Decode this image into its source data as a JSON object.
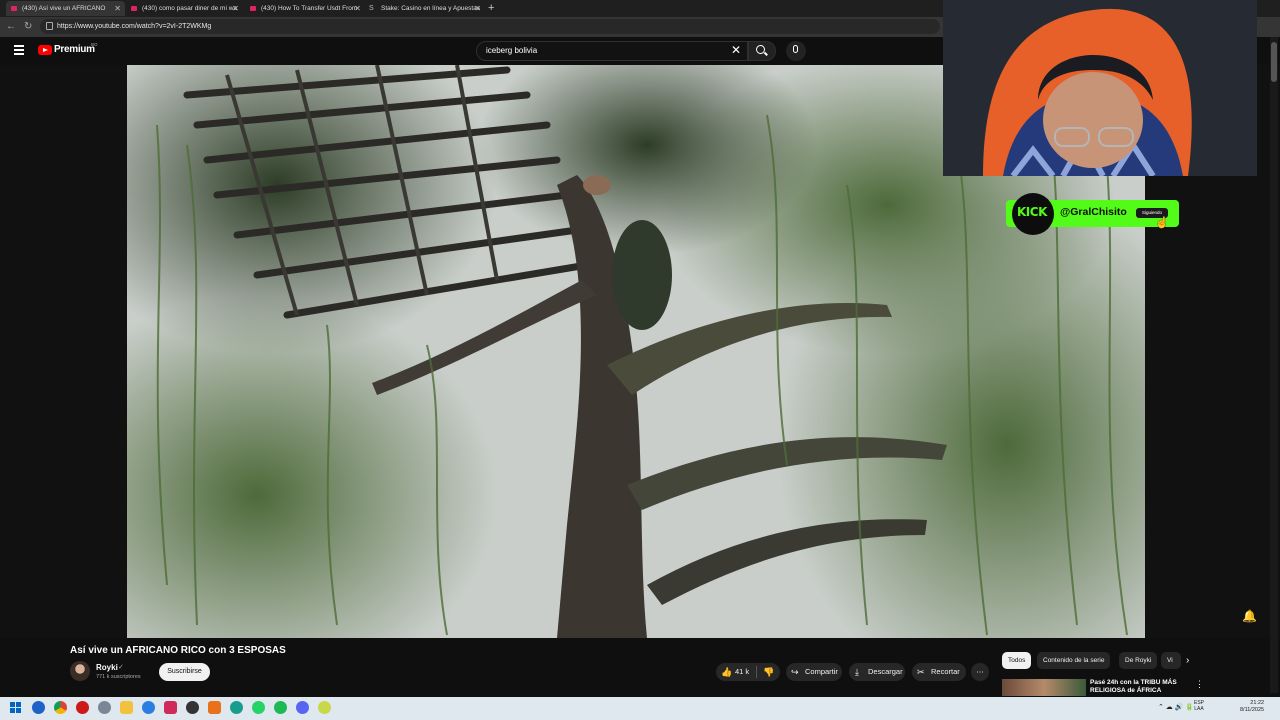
{
  "browser": {
    "tabs": [
      {
        "label": "(430) Así vive un AFRICANO",
        "active": true
      },
      {
        "label": "(430) como pasar diner de mi wa",
        "active": false
      },
      {
        "label": "(430) How To Transfer Usdt From",
        "active": false
      },
      {
        "label": "Stake: Casino en línea y Apuestas",
        "active": false
      }
    ],
    "url": "https://www.youtube.com/watch?v=2vI-2T2WKMg"
  },
  "youtube": {
    "logo_text": "Premium",
    "logo_country": "BO",
    "search_value": "iceberg bolivia"
  },
  "overlay": {
    "kick_logo": "KICK",
    "kick_handle": "@GralChisito",
    "kick_follow": "Siguiendo",
    "kick_color": "#53fc18"
  },
  "video": {
    "title": "Así vive un AFRICANO RICO con 3 ESPOSAS",
    "channel": "Royki",
    "subscribers": "771 k suscriptores",
    "subscribe_label": "Suscribirse",
    "likes": "41 k",
    "share_label": "Compartir",
    "download_label": "Descargar",
    "clip_label": "Recortar"
  },
  "sidebar": {
    "chips": [
      "Todos",
      "Contenido de la serie",
      "De Royki",
      "Vi"
    ],
    "rec_title": "Pasé 24h con la TRIBU MÁS RELIGIOSA de ÁFRICA"
  },
  "taskbar": {
    "lang_top": "ESP",
    "lang_bottom": "LAA",
    "time": "21:22",
    "date": "8/11/2025"
  }
}
